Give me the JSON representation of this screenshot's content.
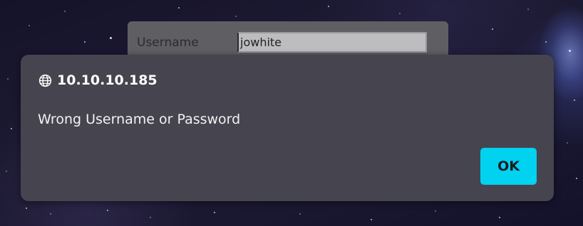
{
  "background_form": {
    "username_label": "Username",
    "username_value": "jowhite"
  },
  "dialog": {
    "origin": "10.10.10.185",
    "origin_icon": "globe-icon",
    "message": "Wrong Username or Password",
    "ok_label": "OK"
  },
  "colors": {
    "dialog_bg": "#46444f",
    "ok_button": "#00d2ef"
  }
}
